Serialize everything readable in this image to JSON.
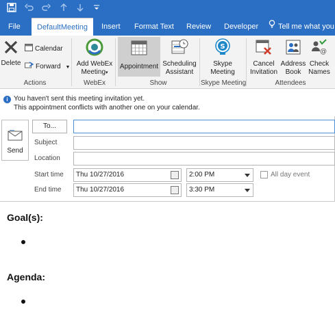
{
  "ribbon_tabs": [
    "File",
    "DefaultMeeting",
    "Insert",
    "Format Text",
    "Review",
    "Developer",
    "Tell me what you"
  ],
  "ribbon": {
    "delete": "Delete",
    "calendar": "Calendar",
    "forward": "Forward",
    "add_webex_1": "Add WebEx",
    "add_webex_2": "Meeting",
    "appointment": "Appointment",
    "scheduling_1": "Scheduling",
    "scheduling_2": "Assistant",
    "skype_1": "Skype",
    "skype_2": "Meeting",
    "cancel_1": "Cancel",
    "cancel_2": "Invitation",
    "address_1": "Address",
    "address_2": "Book",
    "check_1": "Check",
    "check_2": "Names",
    "groups": {
      "actions": "Actions",
      "webex": "WebEx",
      "show": "Show",
      "skype": "Skype Meeting",
      "attendees": "Attendees"
    }
  },
  "info": {
    "line1": "You haven't sent this meeting invitation yet.",
    "line2": "This appointment conflicts with another one on your calendar."
  },
  "form": {
    "send": "Send",
    "to": "To...",
    "subject": "Subject",
    "location": "Location",
    "start_time_label": "Start time",
    "end_time_label": "End time",
    "start_date": "Thu 10/27/2016",
    "start_time": "2:00 PM",
    "end_date": "Thu 10/27/2016",
    "end_time": "3:30 PM",
    "all_day": "All day event"
  },
  "body": {
    "goals": "Goal(s):",
    "agenda": "Agenda:"
  },
  "colors": {
    "accent": "#2b6fc4",
    "ribbon_bg": "#f3f3f3",
    "selected": "#cfcfcf"
  }
}
